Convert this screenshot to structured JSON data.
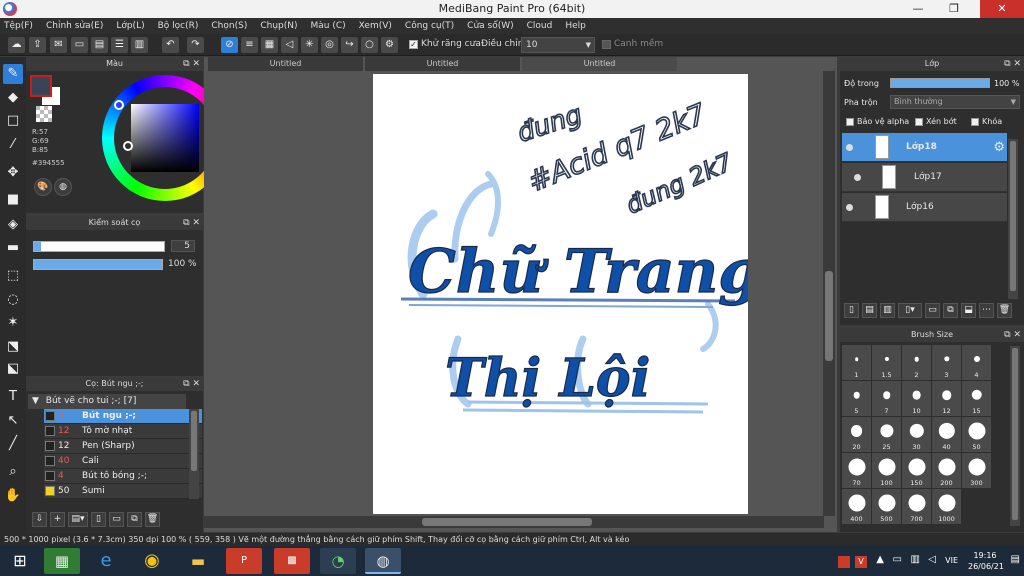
{
  "window": {
    "title": "MediBang Paint Pro (64bit)",
    "minimize": "—",
    "restore": "❐",
    "close": "✕"
  },
  "menu": [
    "Tệp(F)",
    "Chỉnh sửa(E)",
    "Lớp(L)",
    "Bộ lọc(R)",
    "Chọn(S)",
    "Chụp(N)",
    "Màu (C)",
    "Xem(V)",
    "Công cụ(T)",
    "Cửa sổ(W)",
    "Cloud",
    "Help"
  ],
  "toolbar": {
    "antialias_label": "Khử răng cưa",
    "antialias_checked": "✓",
    "adjust_label": "Điều chỉnh",
    "adjust_value": "10",
    "soft_edge_label": "Canh mềm"
  },
  "color_panel": {
    "title": "Màu",
    "r": "R:57",
    "g": "G:69",
    "b": "B:85",
    "hex": "#394555",
    "fg_color": "#394555",
    "bg_color": "#ffffff",
    "accent": "#2f7ed8"
  },
  "brush_control": {
    "title": "Kiểm soát cọ",
    "size": "5",
    "size_fraction": 0.05,
    "opacity": "100 %",
    "opacity_fraction": 1.0
  },
  "brush_list": {
    "title": "Cọ: Bút ngu ;-;",
    "group": "Bút vẽ cho tui ;-; [7]",
    "items": [
      {
        "size": "5",
        "name": "Bút ngu ;-;",
        "swatch": "#222222",
        "selected": true
      },
      {
        "size": "12",
        "name": "Tô mờ nhạt",
        "swatch": "#222222"
      },
      {
        "size": "12",
        "name": "Pen (Sharp)",
        "swatch": "#222222"
      },
      {
        "size": "40",
        "name": "Cali",
        "swatch": "#222222"
      },
      {
        "size": "4",
        "name": "Bút tô bóng ;-;",
        "swatch": "#222222"
      },
      {
        "size": "50",
        "name": "Sumi",
        "swatch": "#f2d21b"
      }
    ]
  },
  "tabs": [
    "Untitled",
    "Untitled",
    "Untitled"
  ],
  "artwork": {
    "line1": "Chữ Trang",
    "line2": "Thị Lội",
    "scribble_a": "đung",
    "scribble_b": "#Acid q7 2k7",
    "scribble_c": "đung 2k7"
  },
  "layers": {
    "title": "Lớp",
    "opacity_label": "Độ trong",
    "opacity": "100 %",
    "blend_label": "Pha trộn",
    "blend": "Bình thường",
    "protect_alpha": "Bảo vệ alpha",
    "clipping": "Xén bớt",
    "lock": "Khóa",
    "items": [
      "Lớp18",
      "Lớp17",
      "Lớp16"
    ]
  },
  "brush_size": {
    "title": "Brush Size",
    "sizes": [
      "1",
      "1.5",
      "2",
      "3",
      "4",
      "5",
      "7",
      "10",
      "12",
      "15",
      "20",
      "25",
      "30",
      "40",
      "50",
      "70",
      "100",
      "150",
      "200",
      "300",
      "400",
      "500",
      "700",
      "1000"
    ]
  },
  "status": "500 * 1000 pixel   (3.6 * 7.3cm)   350 dpi   100 %   ( 559, 358 )   Vẽ một đường thẳng bằng cách giữ phím Shift, Thay đổi cỡ cọ bằng cách giữ phím Ctrl, Alt và kéo",
  "taskbar": {
    "lang": "VIE",
    "time": "19:16",
    "date": "26/06/21"
  }
}
